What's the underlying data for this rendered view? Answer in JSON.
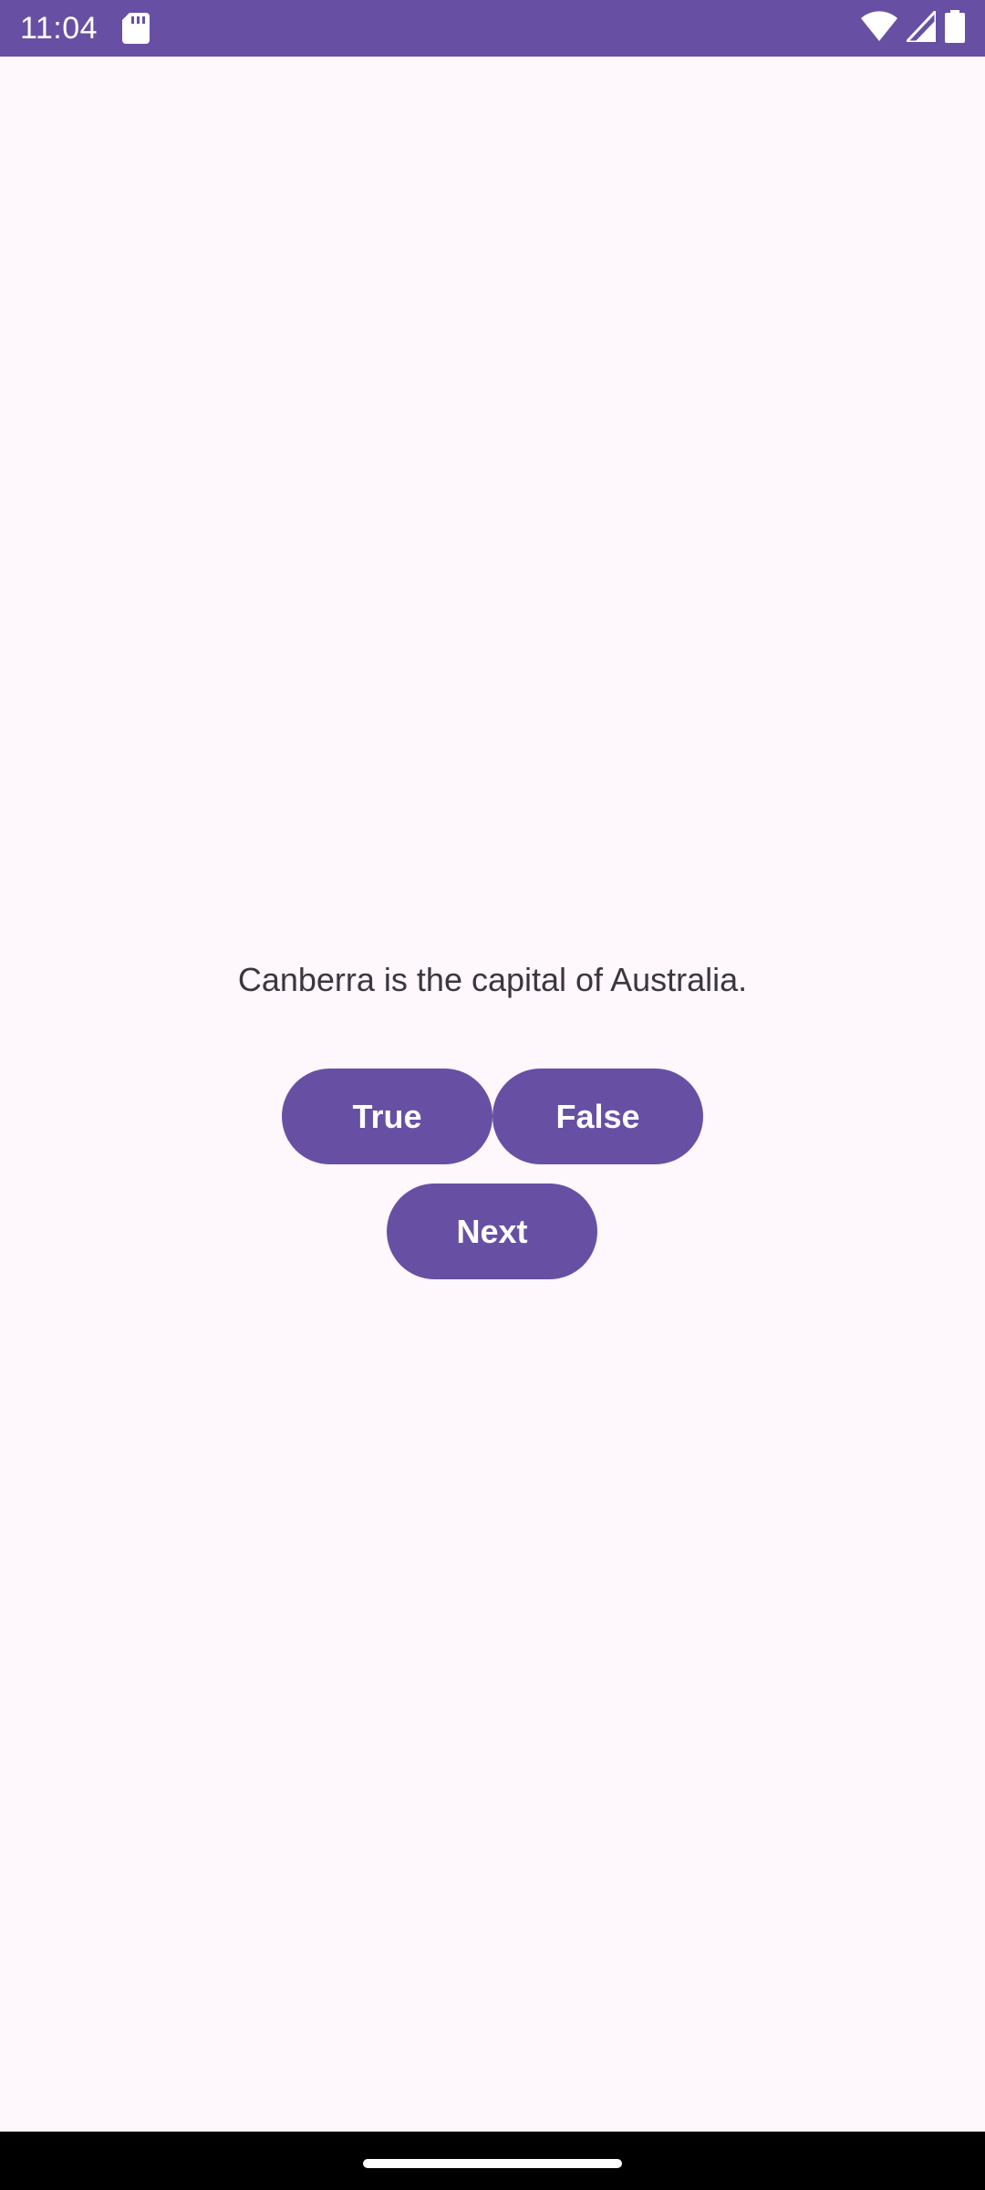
{
  "status_bar": {
    "time": "11:04",
    "background_color": "#6750A4",
    "icons": [
      "sd-card-icon",
      "wifi-icon",
      "signal-icon",
      "battery-icon"
    ]
  },
  "quiz": {
    "question": "Canberra is the capital of Australia.",
    "true_label": "True",
    "false_label": "False",
    "next_label": "Next"
  },
  "colors": {
    "accent": "#6750A4",
    "background": "#FEF7FC",
    "text": "#3A3740"
  }
}
